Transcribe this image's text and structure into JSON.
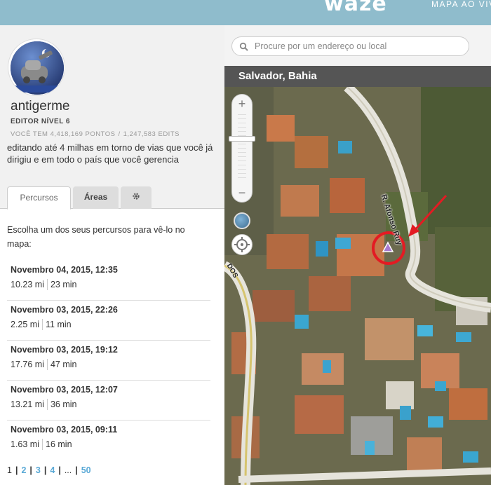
{
  "header": {
    "logo": "waze",
    "map_link": "MAPA AO VIVO"
  },
  "profile": {
    "username": "antigerme",
    "level": "EDITOR NÍVEL 6",
    "points": "VOCÊ TEM 4,418,169 PONTOS",
    "edits": "1,247,583 EDITS",
    "description": "editando até 4 milhas em torno de vias que você já dirigiu e em todo o país que você gerencia"
  },
  "tabs": {
    "routes": "Percursos",
    "areas": "Áreas",
    "settings_icon": "gear-icon"
  },
  "routes": {
    "intro": "Escolha um dos seus percursos para vê-lo no mapa:",
    "items": [
      {
        "date": "Novembro 04, 2015, 12:35",
        "distance": "10.23 mi",
        "duration": "23 min"
      },
      {
        "date": "Novembro 03, 2015, 22:26",
        "distance": "2.25 mi",
        "duration": "11 min"
      },
      {
        "date": "Novembro 03, 2015, 19:12",
        "distance": "17.76 mi",
        "duration": "47 min"
      },
      {
        "date": "Novembro 03, 2015, 12:07",
        "distance": "13.21 mi",
        "duration": "36 min"
      },
      {
        "date": "Novembro 03, 2015, 09:11",
        "distance": "1.63 mi",
        "duration": "16 min"
      }
    ]
  },
  "pagination": {
    "current": "1",
    "pages": [
      "2",
      "3",
      "4"
    ],
    "ellipsis": "...",
    "last": "50"
  },
  "map": {
    "search_placeholder": "Procure por um endereço ou local",
    "location": "Salvador, Bahia",
    "street_label": "R. Afonso Ruy",
    "street_label_2": "DOS",
    "zoom_in": "+",
    "zoom_out": "−"
  },
  "colors": {
    "header": "#8fbccc",
    "link_blue": "#5aa9d6",
    "marker_red": "#e31b23",
    "marker_purple": "#a77bd0"
  }
}
